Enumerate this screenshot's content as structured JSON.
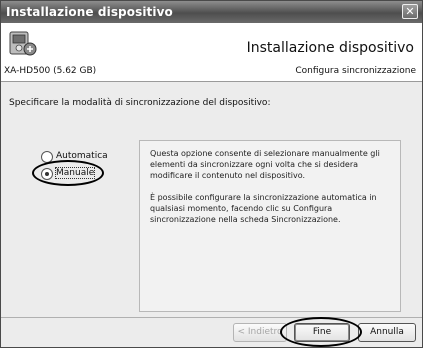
{
  "window": {
    "title": "Installazione dispositivo",
    "close_glyph": "✕"
  },
  "header": {
    "title": "Installazione dispositivo",
    "device": "XA-HD500 (5.62 GB)",
    "sync_config": "Configura sincronizzazione",
    "icon": "device-icon"
  },
  "content": {
    "prompt": "Specificare la modalità di sincronizzazione del dispositivo:",
    "options": [
      {
        "label": "Automatica",
        "selected": false
      },
      {
        "label": "Manuale",
        "selected": true
      }
    ],
    "description": [
      "Questa opzione consente di selezionare manualmente gli elementi da sincronizzare ogni volta che si desidera modificare il contenuto nel dispositivo.",
      "È possibile configurare la sincronizzazione automatica in qualsiasi momento, facendo clic su Configura sincronizzazione nella scheda Sincronizzazione."
    ]
  },
  "buttons": {
    "back": "< Indietro",
    "finish": "Fine",
    "cancel": "Annulla"
  },
  "colors": {
    "titlebar": "#5a5a5a",
    "dialog_bg": "#ececec",
    "header_bg": "#ffffff"
  }
}
